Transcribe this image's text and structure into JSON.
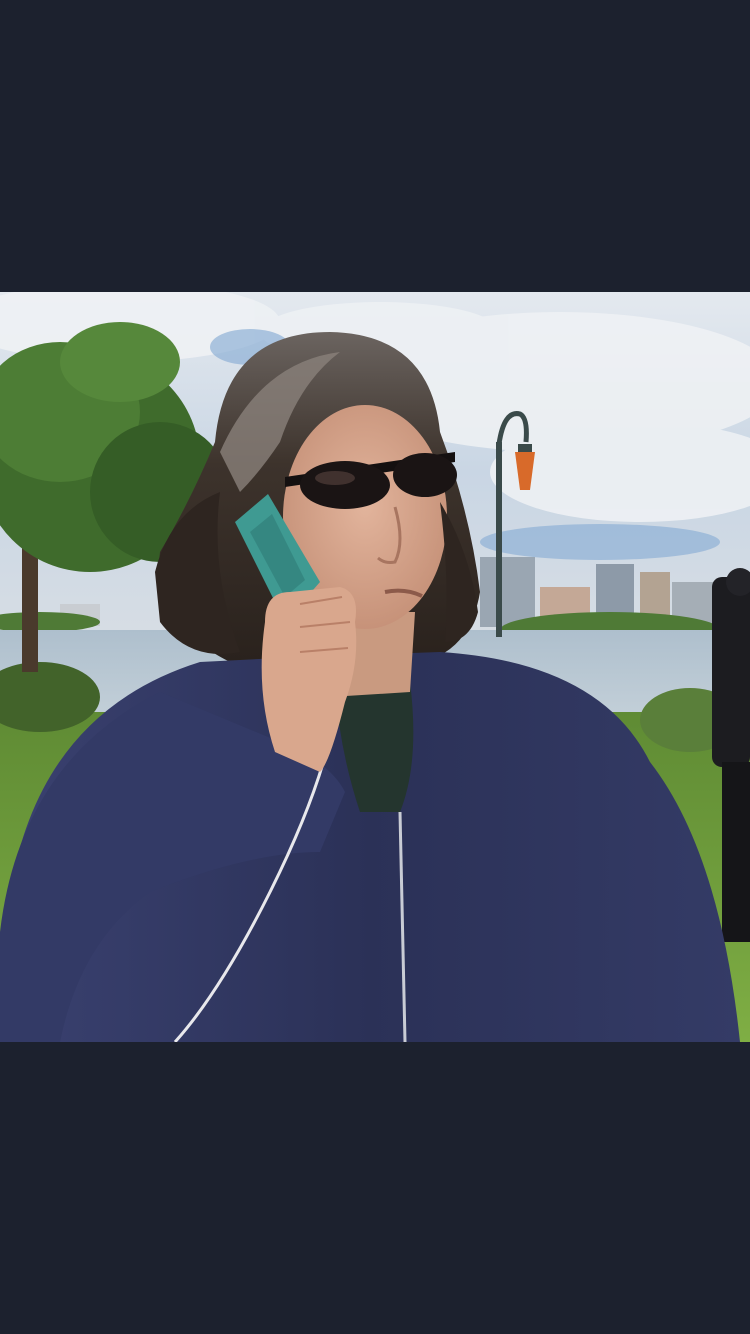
{
  "viewer": {
    "background_color": "#1c212e"
  },
  "photo": {
    "subject": "outdoor-portrait",
    "colors": {
      "sky": "#c9d6e4",
      "grass": "#6f9a3c",
      "water": "#b9c8d4",
      "jacket": "#2e3459",
      "hair": "#3a302a",
      "phone_case": "#3f9a92",
      "sunglasses": "#1a1414",
      "lamp": "#d86a2a"
    }
  }
}
